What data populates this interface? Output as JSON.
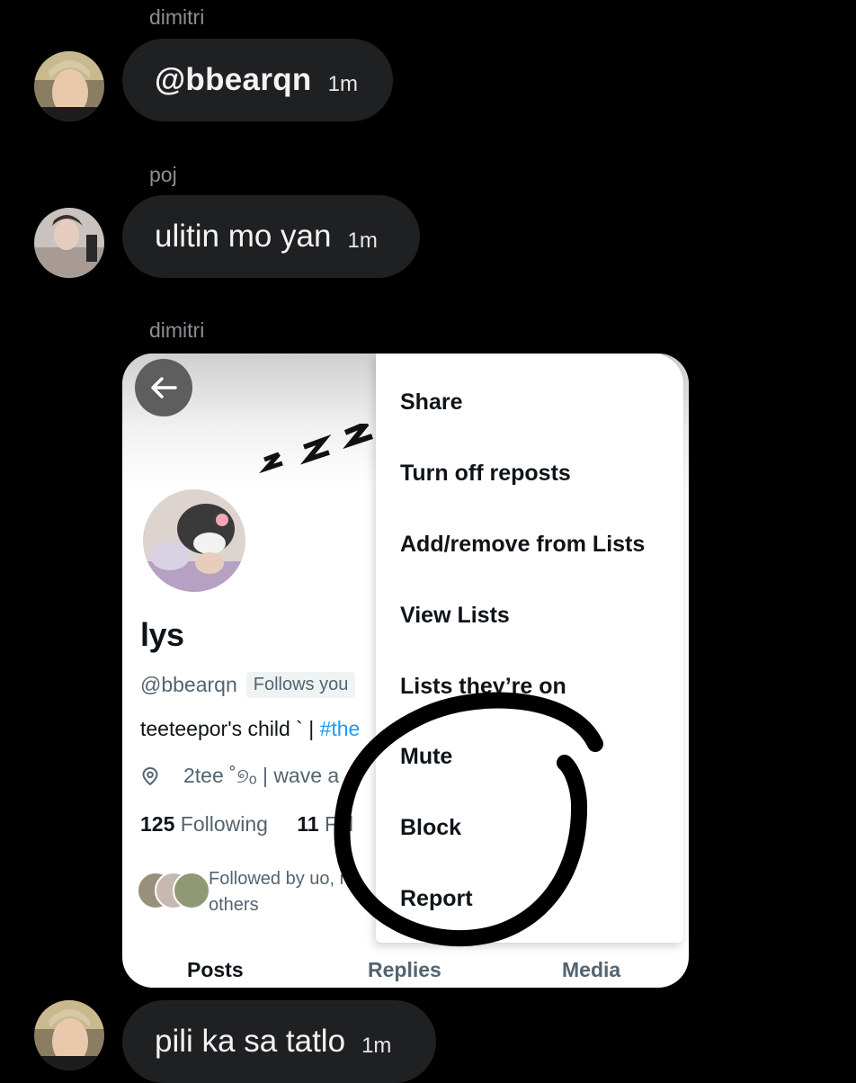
{
  "chat": {
    "messages": [
      {
        "sender": "dimitri",
        "text": "@bbearqn",
        "time": "1m"
      },
      {
        "sender": "poj",
        "text": "ulitin mo yan",
        "time": "1m"
      },
      {
        "sender": "dimitri"
      },
      {
        "text": "pili ka sa tatlo",
        "time": "1m"
      }
    ]
  },
  "profile": {
    "name": "lys",
    "handle": "@bbearqn",
    "follows_you": "Follows you",
    "bio_text": "teeteepor's child ` | ",
    "bio_tag": "#the",
    "location": "2tee ˚୭ₒ | wave a",
    "following_count": "125",
    "following_label": "Following",
    "followers_count": "11",
    "followers_label": "Fol",
    "followed_by": "Followed by u",
    "followed_by_tail": "o, r",
    "followed_by_2": "others",
    "tabs": [
      "Posts",
      "Replies",
      "Media"
    ]
  },
  "menu": {
    "items": [
      "Share",
      "Turn off reposts",
      "Add/remove from Lists",
      "View Lists",
      "Lists they’re on",
      "Mute",
      "Block",
      "Report"
    ]
  },
  "icons": {
    "back": "arrow-left-icon",
    "location": "location-pin-icon",
    "sleep": "zzz-icon"
  },
  "colors": {
    "background": "#000000",
    "bubble": "#1f2022",
    "link": "#1d9bf0",
    "secondary_text": "#536471"
  }
}
